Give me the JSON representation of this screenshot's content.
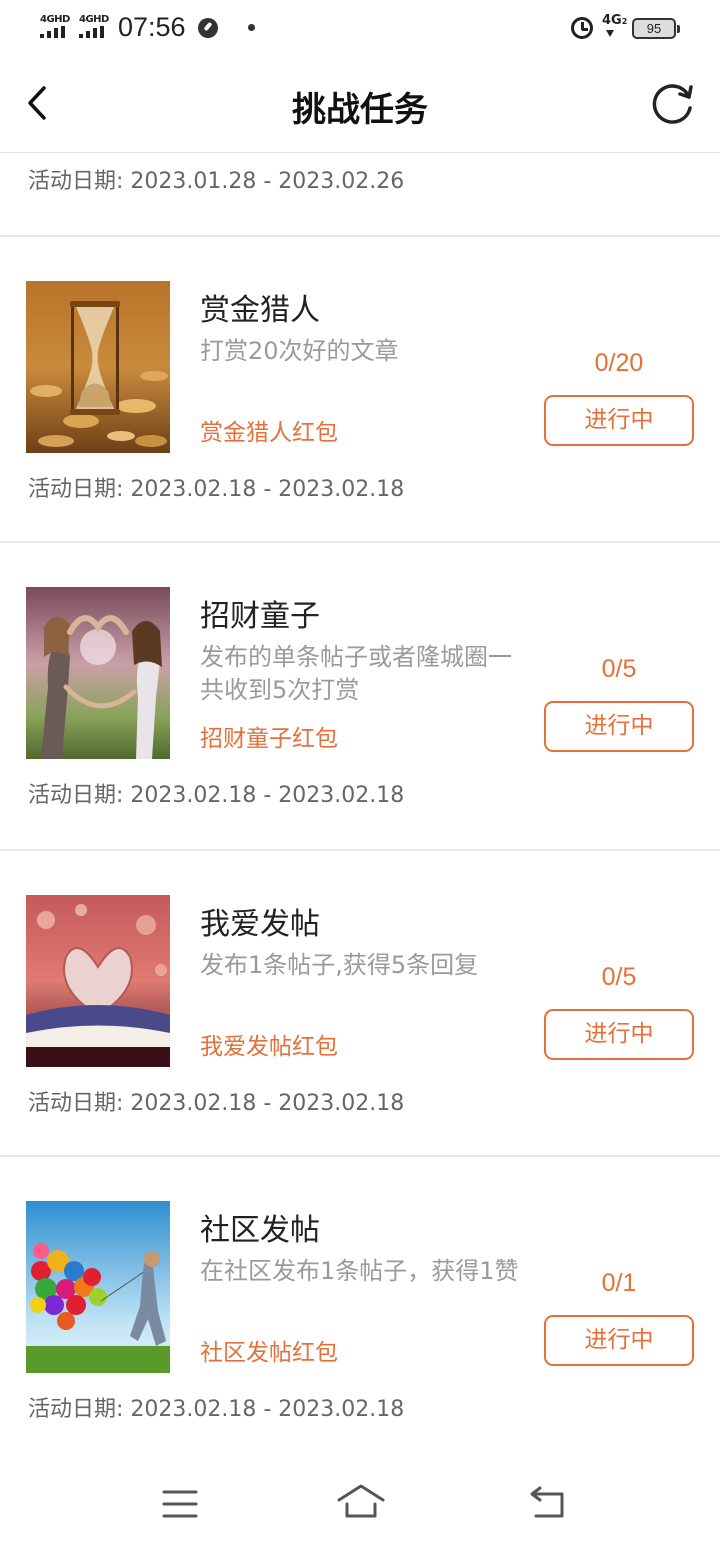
{
  "status_bar": {
    "signal1": "4GHD",
    "signal2": "4GHD",
    "time": "07:56",
    "network": "4G",
    "network_sub": "2",
    "battery": "95"
  },
  "header": {
    "title": "挑战任务",
    "back_icon": "chevron-left-icon",
    "refresh_icon": "refresh-icon"
  },
  "date_label": "活动日期:",
  "first_card_date": "2023.01.28 - 2023.02.26",
  "tasks": [
    {
      "title": "赏金猎人",
      "desc": "打赏20次好的文章",
      "reward": "赏金猎人红包",
      "progress": "0/20",
      "status": "进行中",
      "date": "2023.02.18 - 2023.02.18",
      "image": "hourglass-coins"
    },
    {
      "title": "招财童子",
      "desc": "发布的单条帖子或者隆城圈一共收到5次打赏",
      "reward": "招财童子红包",
      "progress": "0/5",
      "status": "进行中",
      "date": "2023.02.18 - 2023.02.18",
      "image": "girls-heart-hands"
    },
    {
      "title": "我爱发帖",
      "desc": "发布1条帖子,获得5条回复",
      "reward": "我爱发帖红包",
      "progress": "0/5",
      "status": "进行中",
      "date": "2023.02.18 - 2023.02.18",
      "image": "book-heart-pages"
    },
    {
      "title": "社区发帖",
      "desc": "在社区发布1条帖子，获得1赞",
      "reward": "社区发帖红包",
      "progress": "0/1",
      "status": "进行中",
      "date": "2023.02.18 - 2023.02.18",
      "image": "child-balloons"
    }
  ],
  "nav": {
    "menu_icon": "menu-icon",
    "home_icon": "home-icon",
    "back_icon": "back-icon"
  },
  "colors": {
    "accent": "#e6703a",
    "muted_text": "#9a9a9a",
    "date_text": "#666666",
    "divider": "#e6e6e6"
  }
}
